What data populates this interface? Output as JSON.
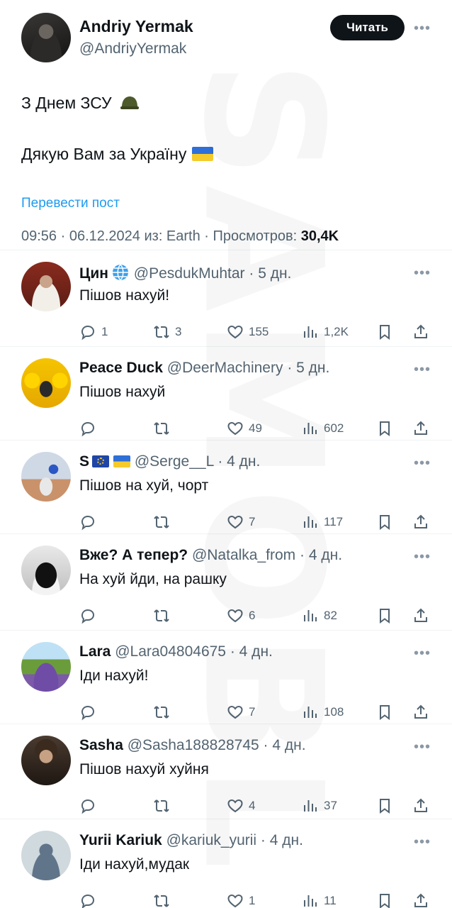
{
  "main_post": {
    "author_name": "Andriy Yermak",
    "author_handle": "@AndriyYermak",
    "follow_label": "Читать",
    "line1": "З Днем ЗСУ",
    "line2": "Дякую Вам за Україну",
    "translate_label": "Перевести пост",
    "meta_prefix": "09:56 · 06.12.2024 из: Earth · Просмотров:",
    "views": "30,4K"
  },
  "replies": [
    {
      "name": "Цин",
      "handle": "@PesdukMuhtar",
      "time": "5 дн.",
      "text": "Пішов нахуй!",
      "replies": "1",
      "reposts": "3",
      "likes": "155",
      "views": "1,2K"
    },
    {
      "name": "Peace Duck",
      "handle": "@DeerMachinery",
      "time": "5 дн.",
      "text": "Пішов нахуй",
      "replies": "",
      "reposts": "",
      "likes": "49",
      "views": "602"
    },
    {
      "name": "S",
      "handle": "@Serge__L",
      "time": "4 дн.",
      "text": "Пішов на хуй, чорт",
      "replies": "",
      "reposts": "",
      "likes": "7",
      "views": "117"
    },
    {
      "name": "Вже? А тепер?",
      "handle": "@Natalka_from",
      "time": "4 дн.",
      "text": "На хуй йди, на рашку",
      "replies": "",
      "reposts": "",
      "likes": "6",
      "views": "82"
    },
    {
      "name": "Lara",
      "handle": "@Lara04804675",
      "time": "4 дн.",
      "text": "Іди нахуй!",
      "replies": "",
      "reposts": "",
      "likes": "7",
      "views": "108"
    },
    {
      "name": "Sasha",
      "handle": "@Sasha188828745",
      "time": "4 дн.",
      "text": "Пішов нахуй хуйня",
      "replies": "",
      "reposts": "",
      "likes": "4",
      "views": "37"
    },
    {
      "name": "Yurii Kariuk",
      "handle": "@kariuk_yurii",
      "time": "4 дн.",
      "text": "Іди нахуй,мудак",
      "replies": "",
      "reposts": "",
      "likes": "1",
      "views": "11"
    }
  ],
  "colors": {
    "accent": "#1d9bf0",
    "text": "#0f1419",
    "secondary": "#536471"
  }
}
